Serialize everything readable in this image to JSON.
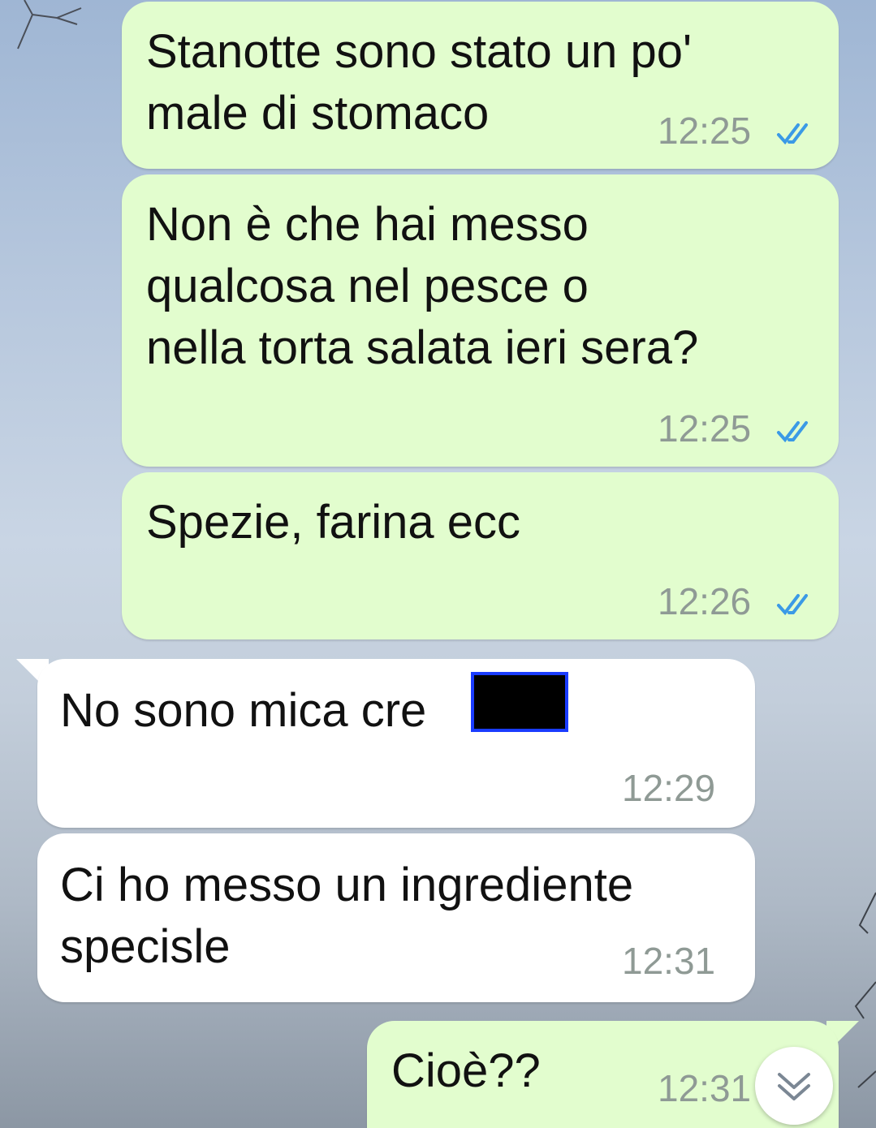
{
  "messages": [
    {
      "direction": "outgoing",
      "text": "Stanotte sono stato un po'\nmale di stomaco",
      "time": "12:25",
      "status": "read"
    },
    {
      "direction": "outgoing",
      "text": "Non è che hai messo\nqualcosa nel pesce o\nnella torta salata ieri sera?",
      "time": "12:25",
      "status": "read"
    },
    {
      "direction": "outgoing",
      "text": "Spezie, farina ecc",
      "time": "12:26",
      "status": "read"
    },
    {
      "direction": "incoming",
      "text": "No sono mica cre",
      "time": "12:29"
    },
    {
      "direction": "incoming",
      "text": "Ci ho messo un ingrediente\nspecisle",
      "time": "12:31"
    },
    {
      "direction": "outgoing",
      "text": "Cioè??",
      "time": "12:31",
      "status": "read"
    }
  ],
  "icons": {
    "read_receipt": "double-check-icon",
    "scroll_down": "chevron-double-down-icon"
  },
  "colors": {
    "outgoing_bubble": "#e2fdce",
    "incoming_bubble": "#ffffff",
    "read_tick": "#3b9ae6",
    "timestamp": "#8f9a95",
    "redaction_border": "#1a3cff"
  }
}
